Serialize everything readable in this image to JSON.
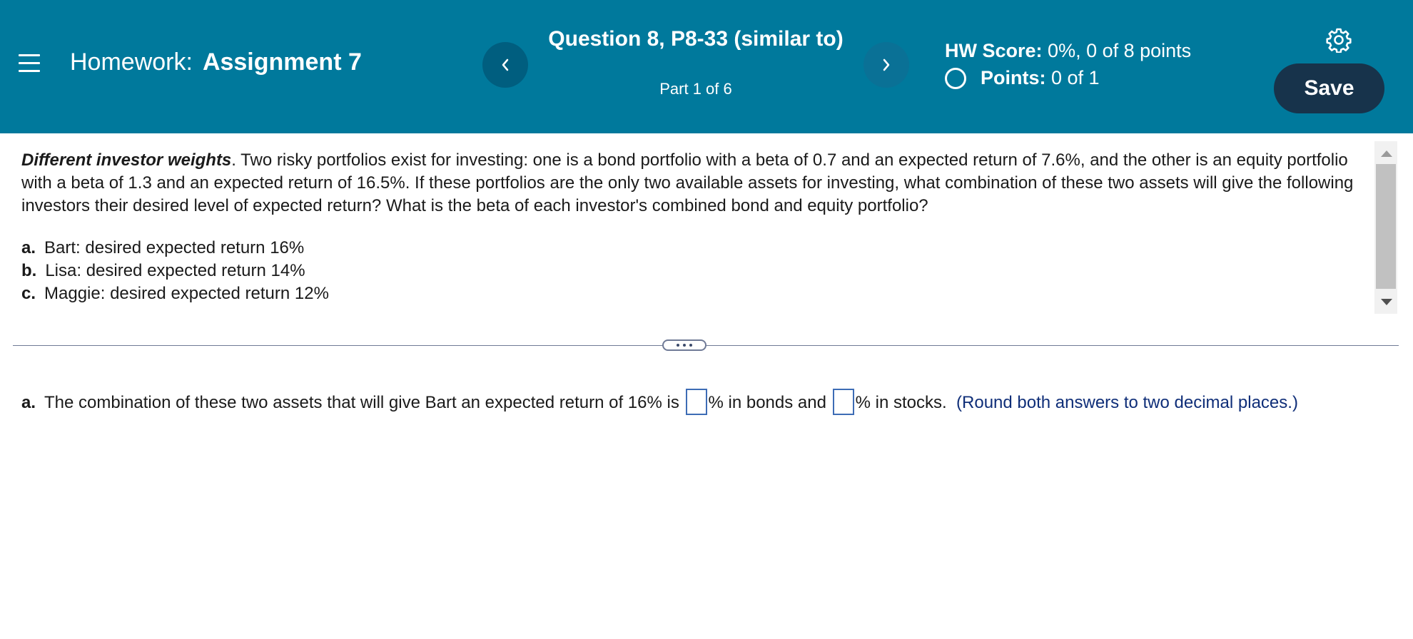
{
  "header": {
    "homework_prefix": "Homework:",
    "assignment_name": "Assignment 7",
    "question_title": "Question 8, P8-33 (similar to)",
    "question_part": "Part 1 of 6",
    "hw_score_label": "HW Score:",
    "hw_score_value": "0%, 0 of 8 points",
    "points_label": "Points:",
    "points_value": "0 of 1",
    "save_label": "Save",
    "prev_glyph": "‹",
    "next_glyph": "›",
    "icons": [
      "menu-icon",
      "chevron-left-icon",
      "chevron-right-icon",
      "gear-icon",
      "status-circle-icon"
    ]
  },
  "question": {
    "lead": "Different investor weights",
    "body": ". Two risky portfolios exist for investing: one is a bond portfolio with a beta of 0.7 and an expected return of 7.6%, and the other is an equity portfolio with a beta of 1.3 and an expected return of 16.5%. If these portfolios are the only two available assets for investing, what combination of these two assets will give the following investors their desired level of expected return? What is the beta of each investor's combined bond and equity portfolio?",
    "parts": [
      {
        "label": "a.",
        "text": "Bart: desired expected return 16%"
      },
      {
        "label": "b.",
        "text": "Lisa: desired expected return 14%"
      },
      {
        "label": "c.",
        "text": "Maggie: desired expected return 12%"
      }
    ]
  },
  "answer": {
    "label": "a.",
    "text_before": "The combination of these two assets that will give Bart an expected return of 16% is",
    "text_middle": "% in bonds and",
    "text_after": "% in stocks.",
    "hint": "(Round both answers to two decimal places.)",
    "bonds_value": "",
    "stocks_value": ""
  },
  "colors": {
    "header_bg": "#00799c",
    "save_bg": "#17334b",
    "hint": "#0f2e78",
    "input_border": "#3d6cb5"
  }
}
